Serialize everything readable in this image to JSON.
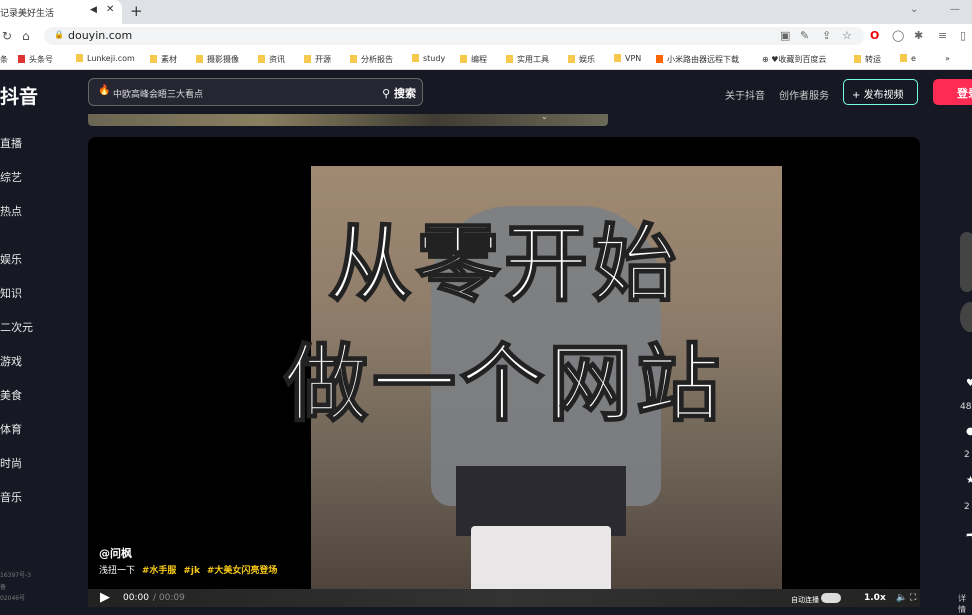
{
  "browser": {
    "tab_title": "记录美好生活",
    "url": "douyin.com",
    "bookmarks": [
      "条",
      "头条号",
      "Lunkeji.com",
      "素材",
      "摄影摄像",
      "资讯",
      "开源",
      "分析报告",
      "study",
      "编程",
      "实用工具",
      "娱乐",
      "VPN",
      "小米路由器远程下载",
      "收藏到百度云",
      "转运",
      "e"
    ]
  },
  "header": {
    "logo": "抖音",
    "search_value": "中欧高峰会晤三大看点",
    "search_button": "搜索",
    "links": [
      "关于抖音",
      "创作者服务"
    ],
    "publish": "发布视频",
    "login": "登录"
  },
  "sidebar": {
    "items": [
      "直播",
      "综艺",
      "热点",
      "娱乐",
      "知识",
      "二次元",
      "游戏",
      "美食",
      "体育",
      "时尚",
      "音乐"
    ],
    "footer": [
      "16397号-3",
      "备",
      "02046号"
    ]
  },
  "video": {
    "overlay_line1": "从零开始",
    "overlay_line2": "做一个网站",
    "author": "@问枫",
    "desc": "浅扭一下",
    "tags": [
      "#水手服",
      "#jk",
      "#大美女闪亮登场"
    ],
    "current_time": "00:00",
    "duration": "00:09",
    "autoplay_label": "自动连播",
    "speed": "1.0x",
    "detail": "详情"
  },
  "actions": {
    "counts": [
      "48",
      "2",
      "2"
    ]
  },
  "colors": {
    "accent": "#fe2c55",
    "bg": "#161823",
    "tag": "#facc15"
  }
}
